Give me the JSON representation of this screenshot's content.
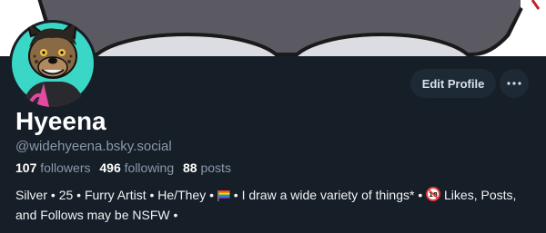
{
  "profile": {
    "display_name": "Hyeena",
    "handle": "@widehyeena.bsky.social",
    "avatar_alt": "hyena-avatar"
  },
  "actions": {
    "edit_profile_label": "Edit Profile",
    "more_icon": "ellipsis-icon"
  },
  "stats": {
    "followers_count": "107",
    "followers_label": "followers",
    "following_count": "496",
    "following_label": "following",
    "posts_count": "88",
    "posts_label": "posts"
  },
  "bio": {
    "part1": "Silver • 25 • Furry Artist • He/They • ",
    "part2": " • I draw a wide variety of things* • ",
    "part3": " Likes, Posts, and Follows may be NSFW •",
    "flag_icon": "rainbow-flag-icon",
    "age_icon": "no-under-18-icon"
  },
  "colors": {
    "background": "#161e27",
    "button": "#1e2936",
    "muted_text": "#8a99ab",
    "avatar_ring": "#3bd7c6"
  }
}
